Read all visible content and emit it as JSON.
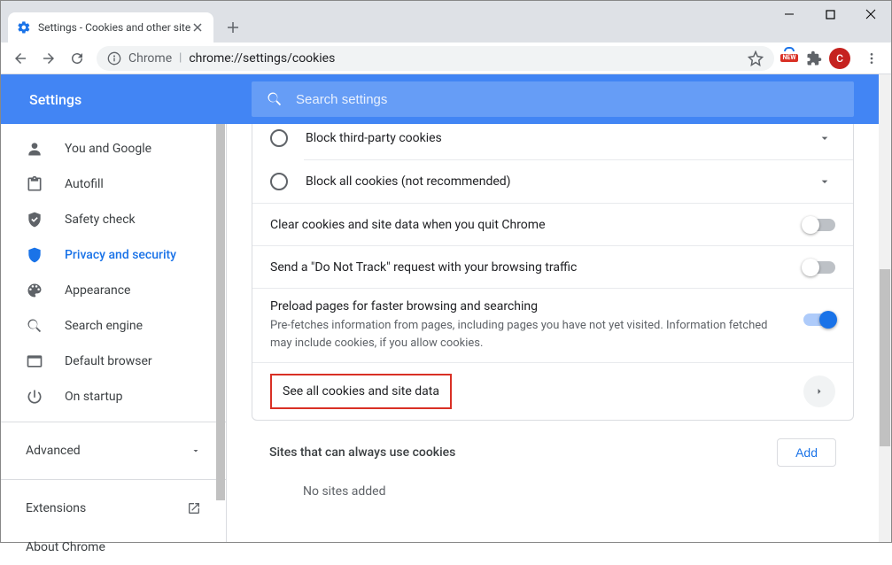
{
  "window": {
    "tab_title": "Settings - Cookies and other site"
  },
  "omnibar": {
    "chip": "Chrome",
    "url": "chrome://settings/cookies",
    "new_badge": "NEW",
    "avatar_letter": "C"
  },
  "header": {
    "title": "Settings",
    "search_placeholder": "Search settings"
  },
  "sidebar": {
    "items": [
      {
        "label": "You and Google"
      },
      {
        "label": "Autofill"
      },
      {
        "label": "Safety check"
      },
      {
        "label": "Privacy and security"
      },
      {
        "label": "Appearance"
      },
      {
        "label": "Search engine"
      },
      {
        "label": "Default browser"
      },
      {
        "label": "On startup"
      }
    ],
    "advanced": "Advanced",
    "extensions": "Extensions",
    "about": "About Chrome"
  },
  "main": {
    "radio1": "Block third-party cookies",
    "radio2": "Block all cookies (not recommended)",
    "row_clear": "Clear cookies and site data when you quit Chrome",
    "row_dnt": "Send a \"Do Not Track\" request with your browsing traffic",
    "row_preload_title": "Preload pages for faster browsing and searching",
    "row_preload_desc": "Pre-fetches information from pages, including pages you have not yet visited. Information fetched may include cookies, if you allow cookies.",
    "row_see_all": "See all cookies and site data",
    "sites_always": "Sites that can always use cookies",
    "add_button": "Add",
    "no_sites": "No sites added"
  }
}
